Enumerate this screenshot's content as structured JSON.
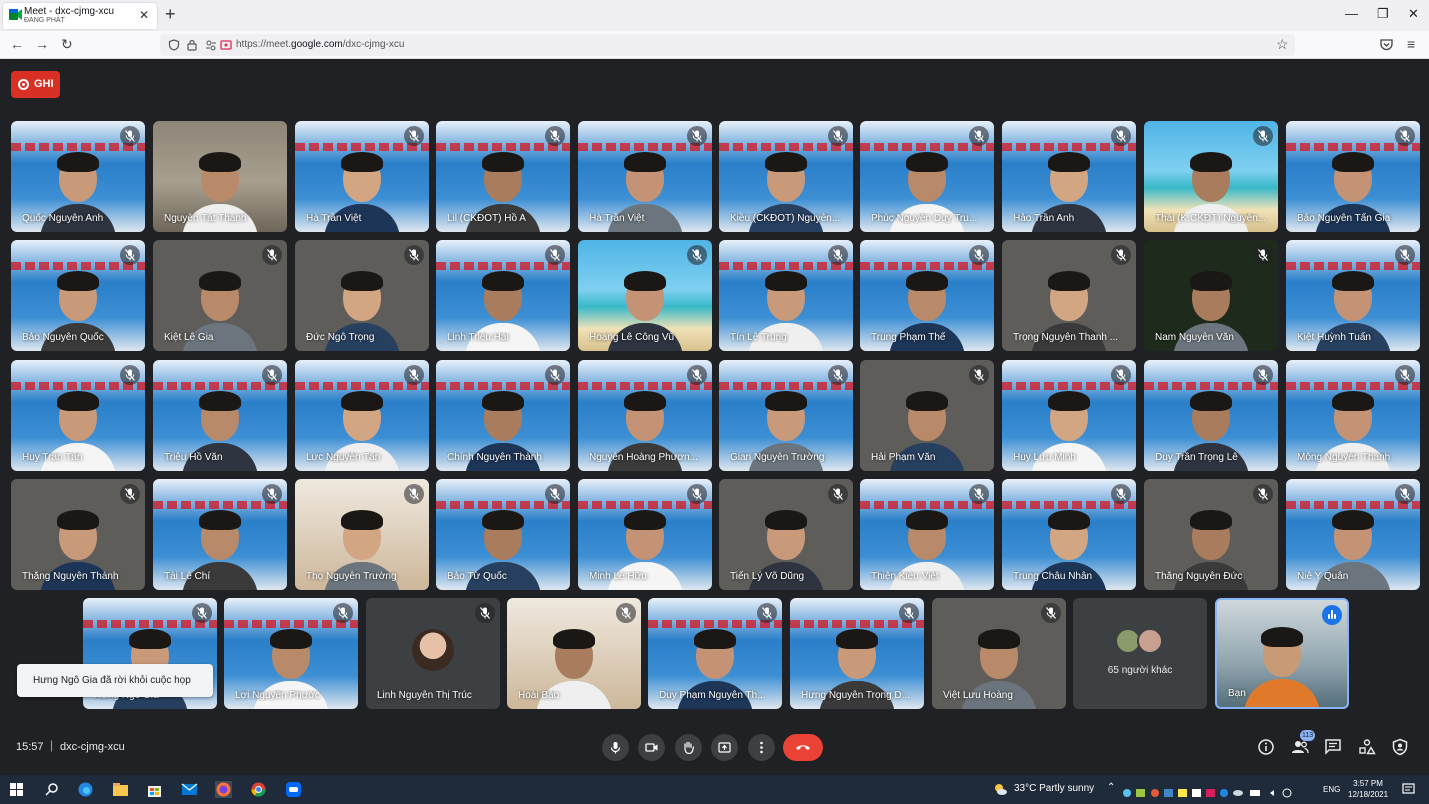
{
  "browser": {
    "tab_title": "Meet - dxc-cjmg-xcu",
    "tab_subtitle": "ĐANG PHÁT",
    "url_prefix": "https://meet.",
    "url_domain": "google.com",
    "url_path": "/dxc-cjmg-xcu"
  },
  "recording": {
    "label": "GHI"
  },
  "participants": [
    {
      "name": "Quốc Nguyễn Anh",
      "bg": "poster",
      "muted": true
    },
    {
      "name": "Nguyễn Tất Thành",
      "bg": "room",
      "muted": false
    },
    {
      "name": "Hà Trần Việt",
      "bg": "poster",
      "muted": true
    },
    {
      "name": "Lil (CKĐOT) Hồ A",
      "bg": "poster",
      "muted": true
    },
    {
      "name": "Hà Trần Việt",
      "bg": "poster",
      "muted": true
    },
    {
      "name": "Kiều (CKĐOT) Nguyễn...",
      "bg": "poster",
      "muted": true
    },
    {
      "name": "Phúc Nguyễn Duy Tru...",
      "bg": "poster",
      "muted": true
    },
    {
      "name": "Hảo Trần Anh",
      "bg": "poster",
      "muted": true
    },
    {
      "name": "Thái (K.CKĐT) Nguyễn...",
      "bg": "beach",
      "muted": true
    },
    {
      "name": "Bảo Nguyễn Tấn Gia",
      "bg": "poster",
      "muted": true
    },
    {
      "name": "Bảo Nguyễn Quốc",
      "bg": "poster",
      "muted": true
    },
    {
      "name": "Kiệt Lê Gia",
      "bg": "gray",
      "muted": true
    },
    {
      "name": "Đức Ngô Trọng",
      "bg": "gray",
      "muted": true
    },
    {
      "name": "Linh Triệu Hải",
      "bg": "poster",
      "muted": true
    },
    {
      "name": "Hoàng Lê Công Vũ",
      "bg": "beach",
      "muted": true
    },
    {
      "name": "Tín Lê Trung",
      "bg": "poster",
      "muted": true
    },
    {
      "name": "Trung Phạm Thế",
      "bg": "poster",
      "muted": true
    },
    {
      "name": "Trọng Nguyễn Thanh ...",
      "bg": "gray",
      "muted": true
    },
    {
      "name": "Nam Nguyễn Văn",
      "bg": "dark",
      "muted": true
    },
    {
      "name": "Kiệt Huỳnh Tuấn",
      "bg": "poster",
      "muted": true
    },
    {
      "name": "Huy Trần Tấn",
      "bg": "poster",
      "muted": true
    },
    {
      "name": "Triệu Hồ Văn",
      "bg": "poster",
      "muted": true
    },
    {
      "name": "Lực Nguyễn Tấn",
      "bg": "poster",
      "muted": true
    },
    {
      "name": "Chính Nguyễn Thành",
      "bg": "poster",
      "muted": true
    },
    {
      "name": "Nguyễn Hoàng Phươn...",
      "bg": "poster",
      "muted": true
    },
    {
      "name": "Gian Nguyễn Trường",
      "bg": "poster",
      "muted": true
    },
    {
      "name": "Hải Phạm Văn",
      "bg": "gray",
      "muted": true
    },
    {
      "name": "Huy Lưu Minh",
      "bg": "poster",
      "muted": true
    },
    {
      "name": "Duy Trần Trọng Lê",
      "bg": "poster",
      "muted": true
    },
    {
      "name": "Mộng Nguyễn Thanh",
      "bg": "poster",
      "muted": true
    },
    {
      "name": "Thắng Nguyễn Thành",
      "bg": "gray",
      "muted": true
    },
    {
      "name": "Tài Lê Chí",
      "bg": "poster",
      "muted": true
    },
    {
      "name": "Thọ Nguyễn Trường",
      "bg": "wall",
      "muted": true
    },
    {
      "name": "Bảo Từ Quốc",
      "bg": "poster",
      "muted": true
    },
    {
      "name": "Minh Lê Hữu",
      "bg": "poster",
      "muted": true
    },
    {
      "name": "Tiến Lý Võ Dũng",
      "bg": "gray",
      "muted": true
    },
    {
      "name": "Thiện Kiều Việt",
      "bg": "poster",
      "muted": true
    },
    {
      "name": "Trung Châu Nhẫn",
      "bg": "poster",
      "muted": true
    },
    {
      "name": "Thắng Nguyễn Đức",
      "bg": "gray",
      "muted": true
    },
    {
      "name": "Niê Y Quân",
      "bg": "poster",
      "muted": true
    },
    {
      "name": "Hưng Ngô Gia",
      "bg": "poster",
      "muted": true
    },
    {
      "name": "Lợi Nguyễn Phước",
      "bg": "poster",
      "muted": true
    },
    {
      "name": "Linh Nguyễn Thị Trúc",
      "bg": "avatar",
      "muted": true
    },
    {
      "name": "Hoài Bảo",
      "bg": "wall",
      "muted": true
    },
    {
      "name": "Duy Phạm Nguyễn Th...",
      "bg": "poster",
      "muted": true
    },
    {
      "name": "Hưng Nguyễn Trọng D...",
      "bg": "poster",
      "muted": true
    },
    {
      "name": "Việt Lưu Hoàng",
      "bg": "gray",
      "muted": true
    }
  ],
  "others_tile": {
    "label": "65 người khác"
  },
  "self_tile": {
    "name": "Bạn"
  },
  "toast": {
    "text": "Hưng Ngô Gia đã rời khỏi cuộc họp"
  },
  "bottom_bar": {
    "time": "15:57",
    "separator": "|",
    "meeting_code": "dxc-cjmg-xcu",
    "participant_count": "113"
  },
  "taskbar": {
    "weather": "33°C  Partly sunny",
    "language": "ENG",
    "time": "3:57 PM",
    "date": "12/18/2021"
  },
  "colors": {
    "meet_bg": "#202124",
    "record_red": "#d93025",
    "end_call_red": "#ea4335",
    "self_border": "#8ab4f8"
  }
}
